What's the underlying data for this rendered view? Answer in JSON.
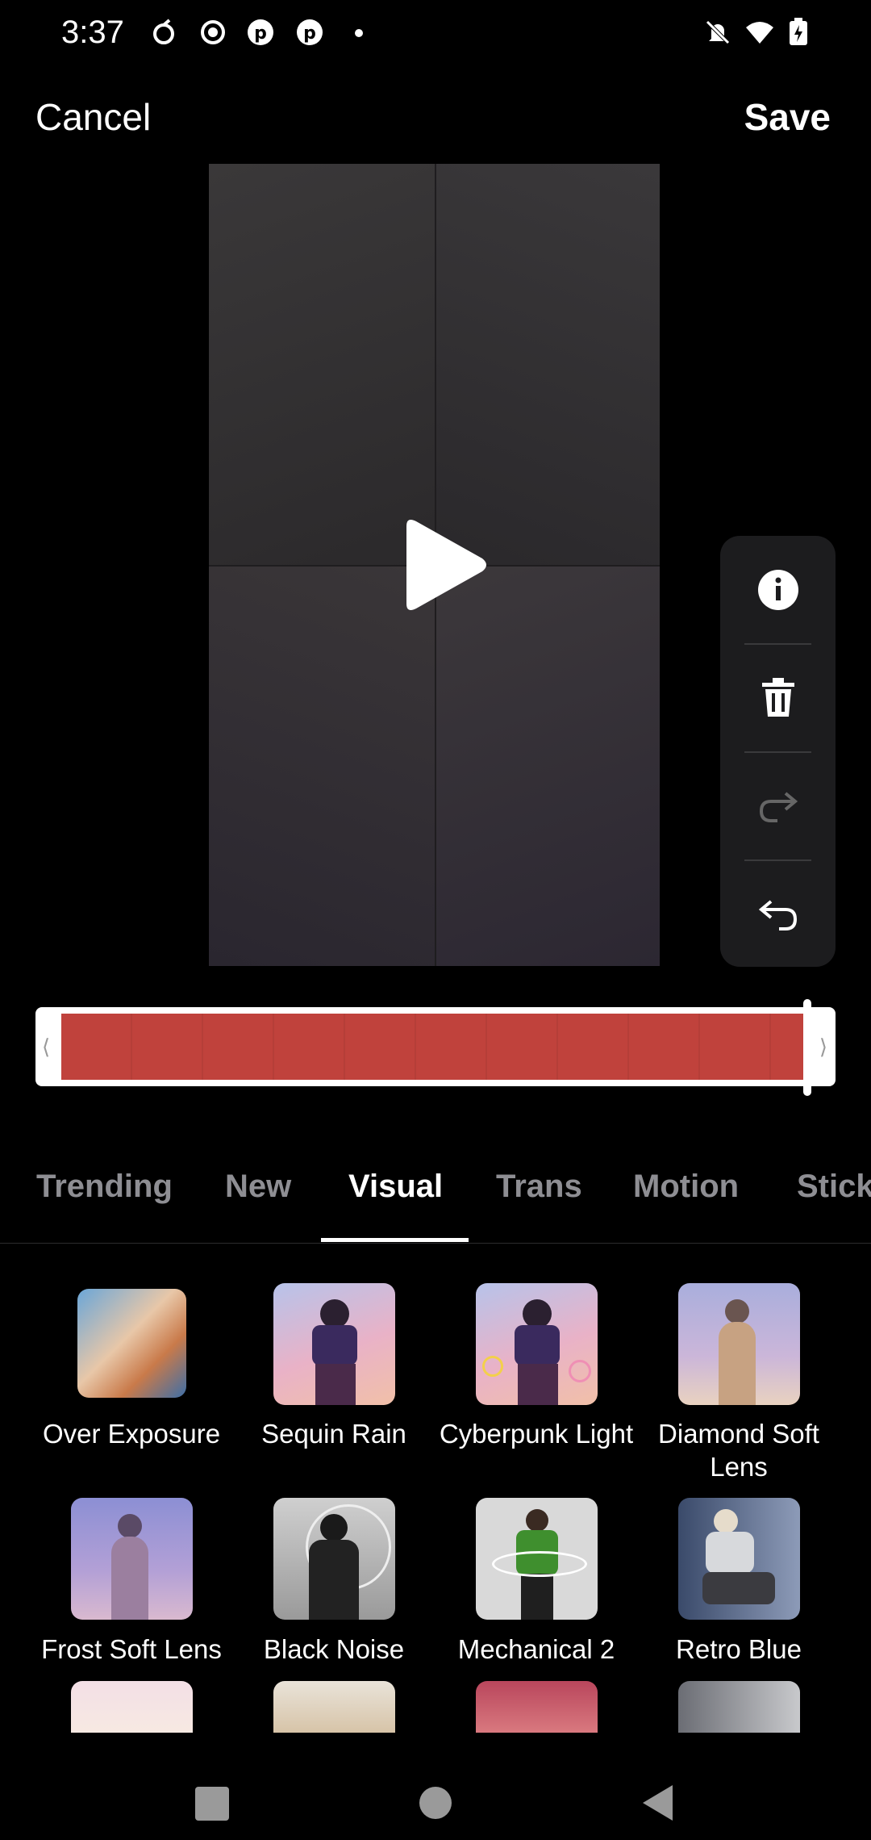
{
  "status_bar": {
    "time": "3:37"
  },
  "top_bar": {
    "cancel_label": "Cancel",
    "save_label": "Save"
  },
  "preview": {
    "play_icon": "play-icon"
  },
  "side_toolbar": {
    "items": [
      "info-icon",
      "trash-icon",
      "redo-icon",
      "undo-icon"
    ]
  },
  "timeline": {
    "left_handle": "⟨",
    "right_handle": "⟩",
    "strip_color": "#c0423c"
  },
  "tabs": {
    "items": [
      "Trending",
      "New",
      "Visual",
      "Trans",
      "Motion",
      "Stick"
    ],
    "active": "Visual"
  },
  "effects": [
    {
      "name": "Over Exposure"
    },
    {
      "name": "Sequin Rain"
    },
    {
      "name": "Cyberpunk Light"
    },
    {
      "name": "Diamond Soft Lens"
    },
    {
      "name": "Frost Soft Lens"
    },
    {
      "name": "Black Noise"
    },
    {
      "name": "Mechanical 2"
    },
    {
      "name": "Retro Blue"
    }
  ],
  "colors": {
    "background": "#000000",
    "accent_red": "#c0423c"
  }
}
